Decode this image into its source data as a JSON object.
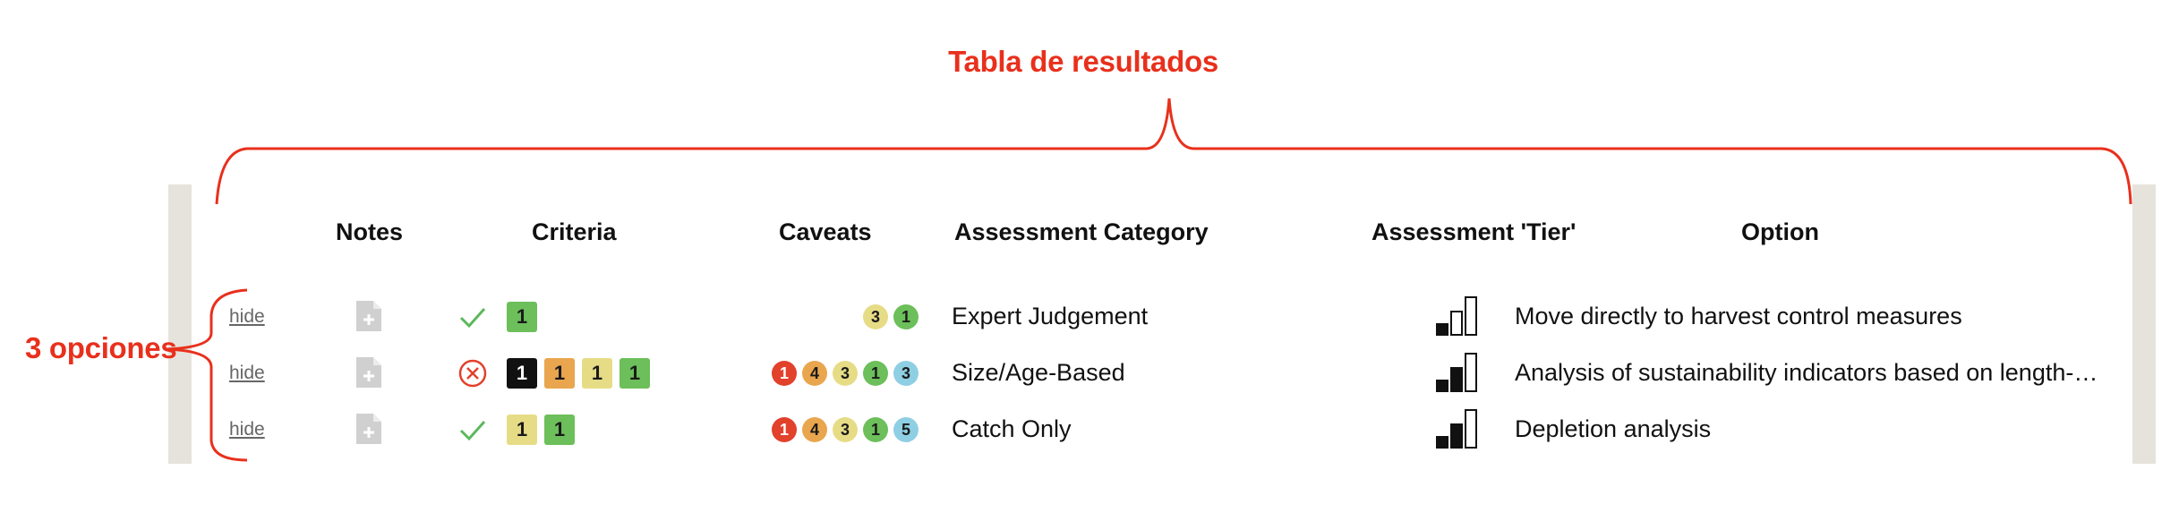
{
  "annotations": {
    "table_title": "Tabla de resultados",
    "options_label": "3 opciones"
  },
  "headers": {
    "notes": "Notes",
    "criteria": "Criteria",
    "caveats": "Caveats",
    "category": "Assessment Category",
    "tier": "Assessment 'Tier'",
    "option": "Option"
  },
  "colors": {
    "annotation_red": "#e8301c",
    "check_green": "#5cb85c",
    "cross_red": "#e2412b",
    "black": "#111111",
    "orange": "#e9a64e",
    "yellow": "#e7dc86",
    "green": "#6cbf5a",
    "blue": "#8fcfe3"
  },
  "rows": [
    {
      "hide": "hide",
      "status": "check-icon",
      "criteria": [
        {
          "label": "1",
          "color": "green"
        }
      ],
      "caveats": [
        {
          "label": "3",
          "color": "yellow"
        },
        {
          "label": "1",
          "color": "green"
        }
      ],
      "category": "Expert Judgement",
      "tier_level": 1,
      "option": "Move directly to harvest control measures"
    },
    {
      "hide": "hide",
      "status": "cross-circle-icon",
      "criteria": [
        {
          "label": "1",
          "color": "black"
        },
        {
          "label": "1",
          "color": "orange"
        },
        {
          "label": "1",
          "color": "yellow"
        },
        {
          "label": "1",
          "color": "green"
        }
      ],
      "caveats": [
        {
          "label": "1",
          "color": "red"
        },
        {
          "label": "4",
          "color": "orange"
        },
        {
          "label": "3",
          "color": "yellow"
        },
        {
          "label": "1",
          "color": "green"
        },
        {
          "label": "3",
          "color": "blue"
        }
      ],
      "category": "Size/Age-Based",
      "tier_level": 2,
      "option": "Analysis of sustainability indicators based on length-…"
    },
    {
      "hide": "hide",
      "status": "check-icon",
      "criteria": [
        {
          "label": "1",
          "color": "yellow"
        },
        {
          "label": "1",
          "color": "green"
        }
      ],
      "caveats": [
        {
          "label": "1",
          "color": "red"
        },
        {
          "label": "4",
          "color": "orange"
        },
        {
          "label": "3",
          "color": "yellow"
        },
        {
          "label": "1",
          "color": "green"
        },
        {
          "label": "5",
          "color": "blue"
        }
      ],
      "category": "Catch Only",
      "tier_level": 2,
      "option": "Depletion analysis"
    }
  ]
}
